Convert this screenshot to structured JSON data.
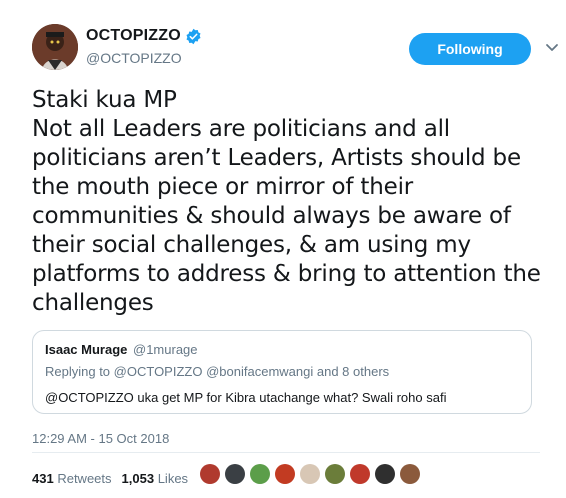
{
  "author": {
    "display_name": "OCTOPIZZO",
    "handle": "@OCTOPIZZO",
    "verified_icon": "verified-badge-icon"
  },
  "follow_button": {
    "label": "Following"
  },
  "menu_icon": "chevron-down-icon",
  "tweet": {
    "lines": [
      "Staki kua MP",
      "Not all Leaders are politicians and  all",
      "politicians aren’t Leaders, Artists should be",
      "the mouth piece or mirror of their",
      "communities & should always be aware of",
      "their social challenges, & am using my",
      "platforms to address & bring to attention the",
      "challenges"
    ]
  },
  "quoted_tweet": {
    "name": "Isaac Murage",
    "handle": "@1murage",
    "replying_prefix": "Replying to",
    "replying_to": "@OCTOPIZZO",
    "replying_others_link": "@bonifacemwangi",
    "replying_others_suffix": "and 8 others",
    "text": "@OCTOPIZZO uka get MP for Kibra utachange what? Swali roho safi"
  },
  "timestamp": "12:29 AM - 15 Oct 2018",
  "stats": {
    "retweets_count": "431",
    "retweets_label": "Retweets",
    "likes_count": "1,053",
    "likes_label": "Likes"
  },
  "likers": [
    {
      "color": "#b03a2e"
    },
    {
      "color": "#3a3f44"
    },
    {
      "color": "#5c9e4a"
    },
    {
      "color": "#c23b22"
    },
    {
      "color": "#d8c7b5"
    },
    {
      "color": "#6b7d3a"
    },
    {
      "color": "#c0392b"
    },
    {
      "color": "#2f2f2f"
    },
    {
      "color": "#8b5a3c"
    }
  ],
  "colors": {
    "accent": "#1da1f2",
    "text": "#14171a",
    "secondary": "#657786"
  }
}
